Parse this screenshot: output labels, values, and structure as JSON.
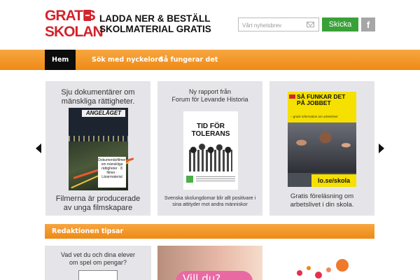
{
  "header": {
    "logo_line1": "GRATIS",
    "logo_line2": "SKOLAN",
    "tagline_line1": "LADDA NER & BESTÄLL",
    "tagline_line2": "SKOLMATERIAL GRATIS",
    "newsletter_placeholder": "Vårt nyhetsbrev",
    "submit_label": "Skicka",
    "facebook_label": "f"
  },
  "nav": {
    "items": [
      {
        "label": "Hem",
        "active": true
      },
      {
        "label": "Sök med nyckelord",
        "active": false
      },
      {
        "label": "Så fungerar det",
        "active": false
      }
    ]
  },
  "carousel": {
    "cards": [
      {
        "title_line1": "Sju dokumentärer om",
        "title_line2": "mänskliga rättigheter.",
        "dvd_title": "ANGELÄGET",
        "dvd_sticker": "Dokumentärfilmer om mänskliga rättigheter · 8 filmer · Lärarmaterial",
        "caption_line1": "Filmerna är producerade",
        "caption_line2": "av unga filmskapare"
      },
      {
        "title_line1": "Ny rapport från",
        "title_line2": "Forum för Levande Historia",
        "report_title_line1": "TID FÖR",
        "report_title_line2": "TOLERANS",
        "caption_line1": "Svenska skolungdomar blir allt positivare i",
        "caption_line2": "sina attityder mot andra människor"
      },
      {
        "poster_headline": "SÅ FUNKAR DET PÅ JOBBET",
        "poster_sub": "– gratis information om arbetslivet",
        "poster_url": "lo.se/skola",
        "caption_line1": "Gratis föreläsning om",
        "caption_line2": "arbetslivet i din skola."
      }
    ]
  },
  "tips": {
    "heading": "Redaktionen tipsar",
    "card1_line1": "Vad vet du och dina elever",
    "card1_line2": "om spel om pengar?",
    "card2_button": "Vill du?"
  },
  "colors": {
    "brand_red": "#d3232d",
    "nav_orange": "#ef8a16",
    "submit_green": "#3aa138",
    "card_gray": "#e5e5e9"
  }
}
